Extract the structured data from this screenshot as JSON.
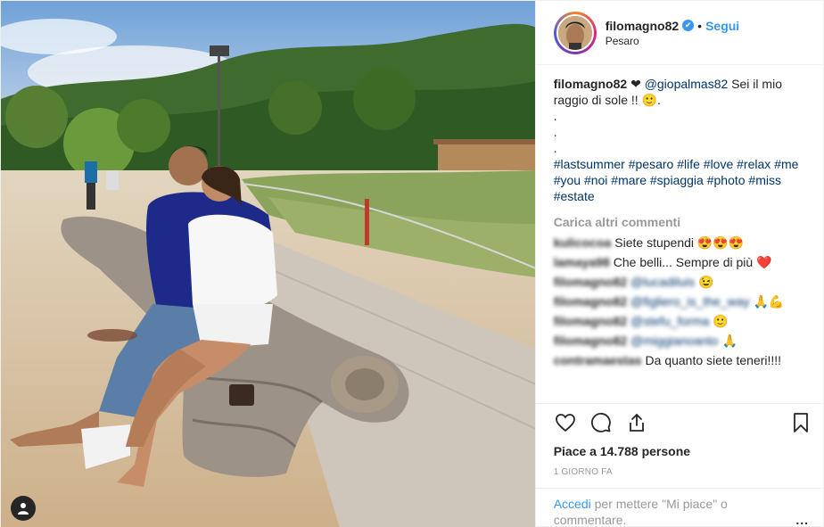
{
  "post": {
    "username": "filomagno82",
    "verified_mark": "✔",
    "separator": "•",
    "follow_label": "Segui",
    "location": "Pesaro"
  },
  "caption": {
    "username": "filomagno82",
    "heart": "❤",
    "mention": "@giopalmas82",
    "text": " Sei il mio raggio di sole !! 🙂.",
    "dot_lines": [
      ".",
      ".",
      "."
    ],
    "hashtags": "#lastsummer #pesaro #life #love #relax #me #you #noi #mare #spiaggia #photo #miss #estate"
  },
  "load_more_label": "Carica altri commenti",
  "comments": [
    {
      "user": "kulicocoa",
      "mention": "",
      "text": "Siete stupendi 😍😍😍"
    },
    {
      "user": "lamaya98",
      "mention": "",
      "text": "Che belli... Sempre di più ❤️"
    },
    {
      "user": "filomagno82",
      "mention": "@lucadiluis",
      "text": "😉"
    },
    {
      "user": "filomagno82",
      "mention": "@figliero_is_the_way",
      "text": "🙏💪"
    },
    {
      "user": "filomagno82",
      "mention": "@stefu_forma",
      "text": "🙂"
    },
    {
      "user": "filomagno82",
      "mention": "@miggianoanto",
      "text": "🙏"
    },
    {
      "user": "contramaestas",
      "mention": "",
      "text": "Da quanto siete teneri!!!!"
    }
  ],
  "likes_text": "Piace a 14.788 persone",
  "time_ago": "1 GIORNO FA",
  "login_link": "Accedi",
  "login_rest": " per mettere \"Mi piace\" o commentare.",
  "more_options": "...",
  "icons": {
    "like": "heart-icon",
    "comment": "comment-icon",
    "share": "share-icon",
    "save": "bookmark-icon",
    "tag": "user-tag-icon"
  },
  "colors": {
    "accent": "#3897f0",
    "link": "#003569",
    "muted": "#999999",
    "text": "#262626",
    "border": "#efefef"
  }
}
